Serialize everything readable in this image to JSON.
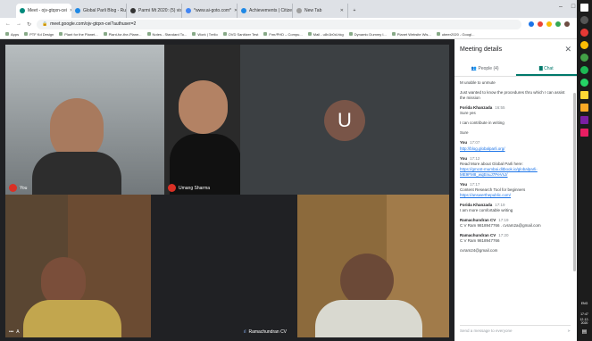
{
  "browser": {
    "tabs": [
      {
        "label": "Meet - ojv-gtqxn-cei",
        "color": "#00897b",
        "active": true
      },
      {
        "label": "Global Parli Blog - Rural Econom",
        "color": "#1e88e5"
      },
      {
        "label": "Parmi Mt 2020: (5) visual keywo",
        "color": "#333333"
      },
      {
        "label": "*www.ai-goto.com*",
        "color": "#4285f4"
      },
      {
        "label": "Achievements | Citizen Parli - Ru",
        "color": "#1e88e5"
      },
      {
        "label": "New Tab",
        "color": "#9e9e9e"
      }
    ],
    "url": "meet.google.com/ojv-gtqxn-cei?authuser=2",
    "bookmarks": [
      "Apps",
      "PTF Kd Design",
      "Plant for the Planet...",
      "Plant-for-the-Plane...",
      "Notes - Standard To...",
      "Work | Trello",
      "OVD Sanitizer Test",
      "Fmr/PHD – Compu...",
      "Mail - u8v1b0d-hkg",
      "Dynamic Dummy I...",
      "Planet Website Wis...",
      "ubeer2020 - Googl..."
    ]
  },
  "meet": {
    "tiles": [
      {
        "name": "You"
      },
      {
        "name": "Umang Sharma"
      },
      {
        "name": "",
        "avatar_letter": "U"
      },
      {
        "name": "A"
      },
      {
        "name": "Ramachundran CV"
      },
      {
        "name": ""
      }
    ]
  },
  "panel": {
    "title": "Meeting details",
    "tab_people": "People (4)",
    "tab_chat": "Chat",
    "messages": [
      {
        "sender": "",
        "time": "",
        "text": "M unable to unmute"
      },
      {
        "sender": "",
        "time": "",
        "text": "Just wanted to know the procedures thru which I can assist the mission"
      },
      {
        "sender": "Forida Khanzada",
        "time": "16:55",
        "text": "Sure yes"
      },
      {
        "sender": "",
        "time": "",
        "text": "I can contribute in writing"
      },
      {
        "sender": "",
        "time": "",
        "text": "Sure"
      },
      {
        "sender": "You",
        "time": "17:07",
        "text": "",
        "link": "http://blog.globalparli.org/"
      },
      {
        "sender": "You",
        "time": "17:12",
        "text": "Read More about Global Parli here:",
        "link": "https://gmcst-mumbai.ditbook.io/globalparli-ME9FM8_wqEnuJ7PeVsJ/"
      },
      {
        "sender": "You",
        "time": "17:17",
        "text": "Content Research Tool for beginners",
        "link": "https://answerthepublic.com/"
      },
      {
        "sender": "Forida Khanzada",
        "time": "17:19",
        "text": "I am more comfortable writing"
      },
      {
        "sender": "Ramachundran CV",
        "time": "17:19",
        "text": "C V Ram 9818947766 . cvram2a@gmail.com"
      },
      {
        "sender": "Ramachundran CV",
        "time": "17:20",
        "text": "C V Ram 9818947766"
      },
      {
        "sender": "",
        "time": "",
        "text": "cvram24@gmail.com"
      }
    ],
    "send_placeholder": "Send a message to everyone"
  },
  "taskbar": {
    "time": "17:47",
    "date": "12-12-2020",
    "lang": "ENG"
  }
}
